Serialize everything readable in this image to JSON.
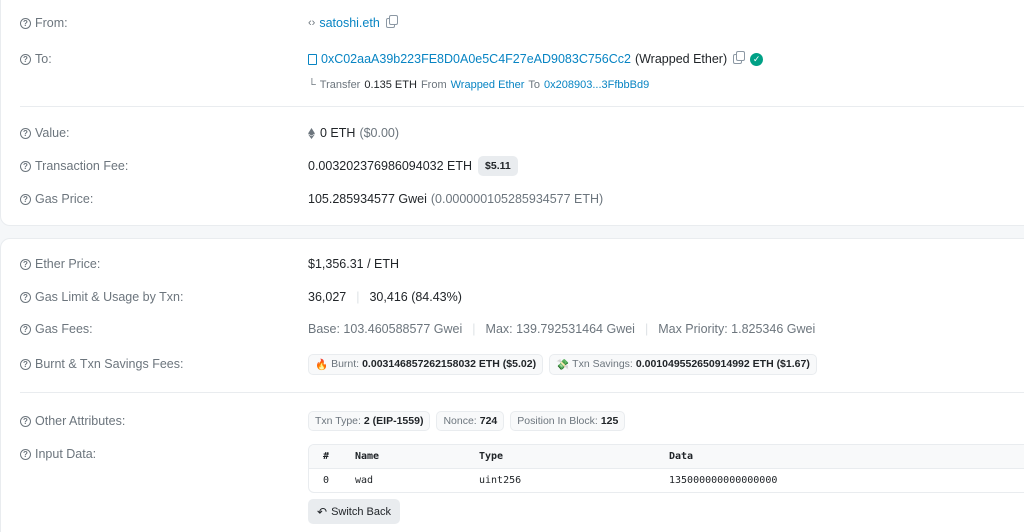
{
  "labels": {
    "from": "From:",
    "to": "To:",
    "value": "Value:",
    "fee": "Transaction Fee:",
    "gas_price": "Gas Price:",
    "ether_price": "Ether Price:",
    "gas_limit": "Gas Limit & Usage by Txn:",
    "gas_fees": "Gas Fees:",
    "burnt": "Burnt & Txn Savings Fees:",
    "other": "Other Attributes:",
    "input": "Input Data:"
  },
  "from": {
    "name": "satoshi.eth"
  },
  "to": {
    "address": "0xC02aaA39b223FE8D0A0e5C4F27eAD9083C756Cc2",
    "name": "(Wrapped Ether)",
    "transfer": {
      "prefix": "└",
      "label": "Transfer",
      "amount": "0.135 ETH",
      "from_label": "From",
      "from": "Wrapped Ether",
      "to_label": "To",
      "to": "0x208903...3FfbbBd9"
    }
  },
  "value": {
    "eth": "0 ETH",
    "usd": "($0.00)"
  },
  "fee": {
    "eth": "0.003202376986094032 ETH",
    "usd": "$5.11"
  },
  "gas_price": {
    "gwei": "105.285934577 Gwei",
    "eth": "(0.000000105285934577 ETH)"
  },
  "ether_price": "$1,356.31 / ETH",
  "gas_limit": {
    "limit": "36,027",
    "sep": "|",
    "usage": "30,416 (84.43%)"
  },
  "gas_fees": {
    "base": "Base: 103.460588577 Gwei",
    "max": "Max: 139.792531464 Gwei",
    "priority": "Max Priority: 1.825346 Gwei",
    "sep": "|"
  },
  "burnt": {
    "burnt_label": "Burnt:",
    "burnt_value": "0.003146857262158032 ETH ($5.02)",
    "savings_label": "Txn Savings:",
    "savings_value": "0.001049552650914992 ETH ($1.67)"
  },
  "attributes": {
    "txn_type_label": "Txn Type:",
    "txn_type": "2 (EIP-1559)",
    "nonce_label": "Nonce:",
    "nonce": "724",
    "position_label": "Position In Block:",
    "position": "125"
  },
  "input_table": {
    "headers": [
      "#",
      "Name",
      "Type",
      "Data"
    ],
    "rows": [
      [
        "0",
        "wad",
        "uint256",
        "135000000000000000"
      ]
    ]
  },
  "switch_back": "Switch Back",
  "colors": {
    "link": "#0784c3",
    "verified": "#00a186"
  }
}
